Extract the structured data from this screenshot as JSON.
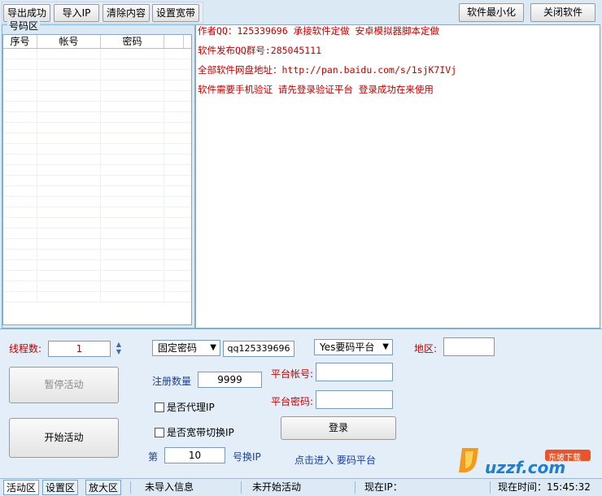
{
  "toolbar": {
    "export_label": "导出成功",
    "import_ip_label": "导入IP",
    "clear_label": "清除内容",
    "broadband_label": "设置宽带",
    "minimize_label": "软件最小化",
    "close_label": "关闭软件"
  },
  "account_group": {
    "title": "号码区",
    "columns": [
      "序号",
      "帐号",
      "密码"
    ]
  },
  "log_lines": [
    "作者QQ：125339696 承接软件定做  安卓模拟器脚本定做",
    "软件发布QQ群号:285045111",
    "全部软件网盘地址：http://pan.baidu.com/s/1sjK7IVj",
    "软件需要手机验证 请先登录验证平台 登录成功在来使用"
  ],
  "controls": {
    "threads_label": "线程数:",
    "threads_value": "1",
    "pause_button": "暂停活动",
    "start_button": "开始活动",
    "password_mode": "固定密码",
    "password_value": "qq125339696",
    "platform_select": "Yes要码平台",
    "region_label": "地区:",
    "region_value": "",
    "register_count_label": "注册数量",
    "register_count_value": "9999",
    "platform_account_label": "平台帐号:",
    "platform_account_value": "",
    "platform_password_label": "平台密码:",
    "platform_password_value": "",
    "proxy_ip_label": "是否代理IP",
    "broadband_switch_label": "是否宽带切换IP",
    "login_button": "登录",
    "switch_prefix": "第",
    "switch_value": "10",
    "switch_suffix": "号换IP",
    "enter_link": "点击进入 要码平台"
  },
  "statusbar": {
    "tabs": [
      "活动区",
      "设置区",
      "放大区"
    ],
    "import_info": "未导入信息",
    "activity_status": "未开始活动",
    "ip_label": "现在IP：",
    "time_label": "现在时间：15:45:32"
  },
  "watermark": {
    "brand": "uzzf.com",
    "tagline": "东坡下载"
  },
  "colors": {
    "accent_red": "#c00000",
    "panel_border": "#7fb2d6",
    "background": "#dbe9f5"
  }
}
